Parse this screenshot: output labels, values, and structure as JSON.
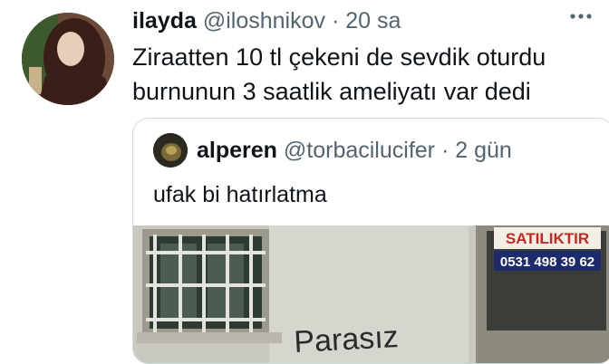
{
  "tweet": {
    "author_name": "ilayda",
    "author_handle": "@iloshnikov",
    "separator": "·",
    "time": "20 sa",
    "text": "Ziraatten 10 tl çekeni de sevdik oturdu burnunun 3 saatlik ameliyatı var dedi",
    "more_icon": "more-dots-icon"
  },
  "quoted_tweet": {
    "author_name": "alperen",
    "author_handle": "@torbacilucifer",
    "separator": "·",
    "time": "2 gün",
    "text": "ufak bi hatırlatma",
    "media": {
      "sign_title": "SATILIKTIR",
      "sign_phone": "0531 498 39 62",
      "graffiti": "Parasız"
    }
  },
  "colors": {
    "text": "#0f1419",
    "secondary": "#536471",
    "border": "#cfd9de",
    "sign_red": "#c8261e",
    "sign_blue": "#1d2a6b"
  }
}
